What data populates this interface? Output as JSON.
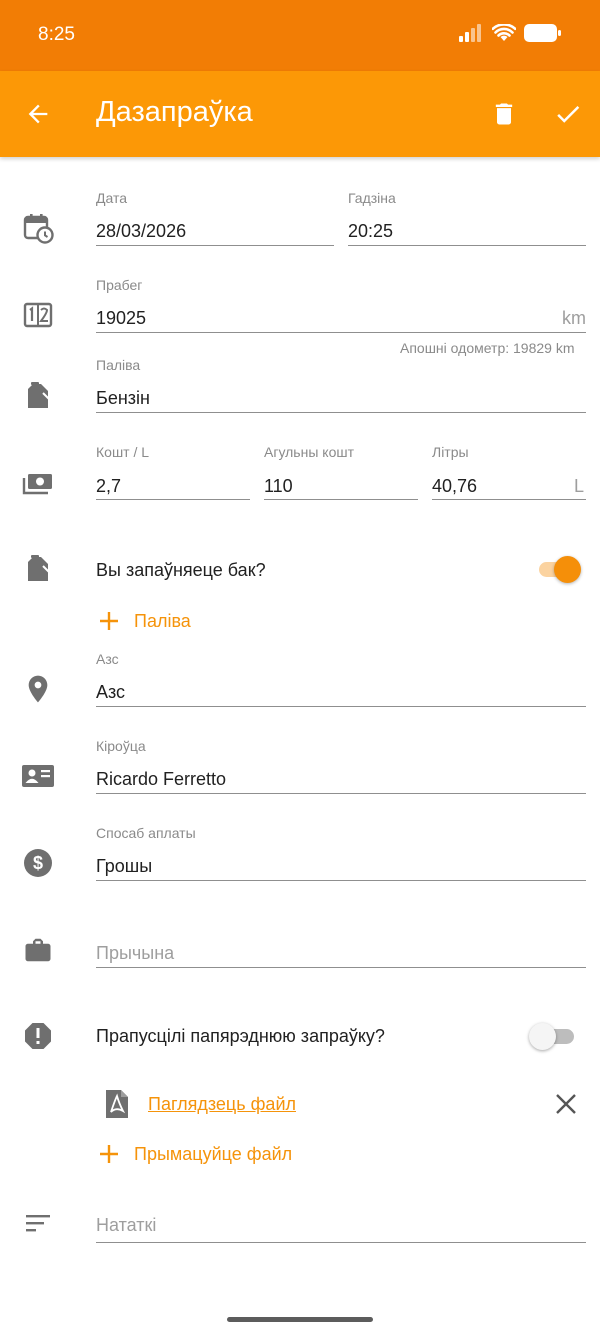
{
  "status_bar": {
    "time": "8:25"
  },
  "app_bar": {
    "title": "Дазапраўка"
  },
  "form": {
    "date": {
      "label": "Дата",
      "value": "28/03/2026"
    },
    "time": {
      "label": "Гадзіна",
      "value": "20:25"
    },
    "odometer": {
      "label": "Прабег",
      "value": "19025",
      "unit": "km",
      "helper": "Апошні одометр: 19829 km"
    },
    "fuel": {
      "label": "Паліва",
      "value": "Бензін"
    },
    "cost_per_l": {
      "label": "Кошт / L",
      "value": "2,7"
    },
    "total_cost": {
      "label": "Агульны кошт",
      "value": "110"
    },
    "liters": {
      "label": "Літры",
      "value": "40,76",
      "unit": "L"
    },
    "full_tank": {
      "label": "Вы запаўняеце бак?",
      "checked": true
    },
    "add_fuel": {
      "label": "Паліва"
    },
    "station": {
      "label": "Азс",
      "value": "Азс"
    },
    "driver": {
      "label": "Кіроўца",
      "value": "Ricardo Ferretto"
    },
    "payment": {
      "label": "Спосаб аплаты",
      "value": "Грошы"
    },
    "reason": {
      "placeholder": "Прычына"
    },
    "missed": {
      "label": "Прапусцілі папярэднюю запраўку?",
      "checked": false
    },
    "file": {
      "label": "Паглядзець файл"
    },
    "attach": {
      "label": "Прымацуйце файл"
    },
    "notes": {
      "placeholder": "Нататкі"
    }
  },
  "colors": {
    "status_bar": "#f27d05",
    "app_bar": "#fc9806",
    "accent": "#f5930a",
    "icon": "#6f6f6f"
  }
}
